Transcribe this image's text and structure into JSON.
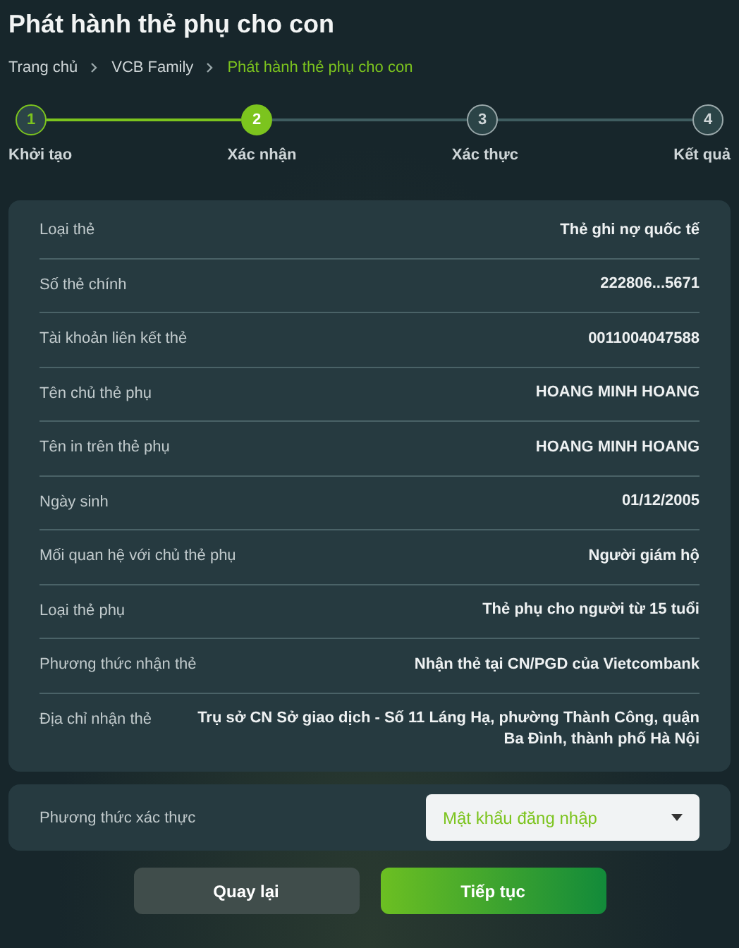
{
  "title": "Phát hành thẻ phụ cho con",
  "breadcrumb": [
    {
      "label": "Trang chủ",
      "current": false
    },
    {
      "label": "VCB Family",
      "current": false
    },
    {
      "label": "Phát hành thẻ phụ cho con",
      "current": true
    }
  ],
  "steps": [
    {
      "number": "1",
      "label": "Khởi tạo",
      "completed": true,
      "selected": false
    },
    {
      "number": "2",
      "label": "Xác nhận",
      "completed": false,
      "selected": true
    },
    {
      "number": "3",
      "label": "Xác thực",
      "completed": false,
      "selected": false
    },
    {
      "number": "4",
      "label": "Kết quả",
      "completed": false,
      "selected": false
    }
  ],
  "details": [
    {
      "label": "Loại thẻ",
      "value": "Thẻ ghi nợ quốc tế"
    },
    {
      "label": "Số thẻ chính",
      "value": "222806...5671"
    },
    {
      "label": "Tài khoản liên kết thẻ",
      "value": "0011004047588"
    },
    {
      "label": "Tên chủ thẻ phụ",
      "value": "HOANG MINH HOANG"
    },
    {
      "label": "Tên in trên thẻ phụ",
      "value": "HOANG MINH HOANG"
    },
    {
      "label": "Ngày sinh",
      "value": "01/12/2005"
    },
    {
      "label": "Mối quan hệ với chủ thẻ phụ",
      "value": "Người giám hộ"
    },
    {
      "label": "Loại thẻ phụ",
      "value": "Thẻ phụ cho người từ 15 tuổi"
    },
    {
      "label": "Phương thức nhận thẻ",
      "value": "Nhận thẻ tại CN/PGD của Vietcombank"
    },
    {
      "label": "Địa chỉ nhận thẻ",
      "value": "Trụ sở CN Sở giao dịch - Số 11 Láng Hạ, phường Thành Công, quận Ba Đình, thành phố Hà Nội"
    }
  ],
  "verification": {
    "label": "Phương thức xác thực",
    "value": "Mật khẩu đăng nhập"
  },
  "buttons": [
    {
      "label": "Quay lại",
      "kind": "secondary"
    },
    {
      "label": "Tiếp tục",
      "kind": "primary"
    }
  ]
}
